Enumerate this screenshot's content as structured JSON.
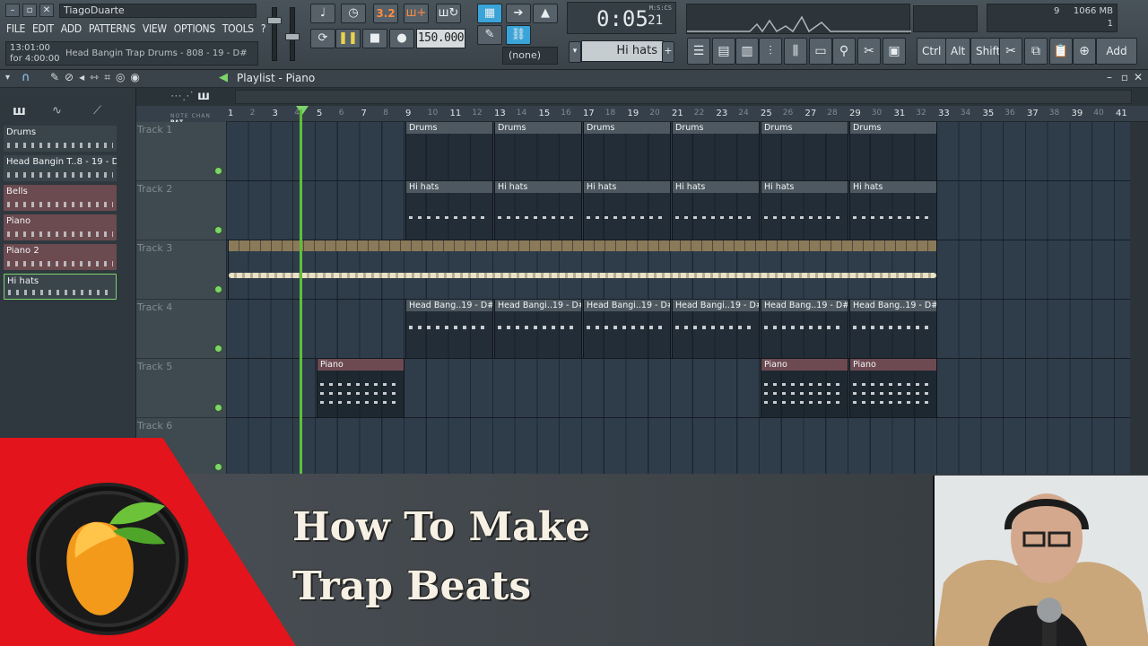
{
  "window": {
    "user": "TiagoDuarte"
  },
  "menu": [
    "FILE",
    "EDIT",
    "ADD",
    "PATTERNS",
    "VIEW",
    "OPTIONS",
    "TOOLS",
    "?"
  ],
  "hint": {
    "time": "13:01:00",
    "length": "for 4:00:00",
    "message": "Head Bangin Trap Drums - 808 - 19 - D#"
  },
  "transport": {
    "tempo": "150.000",
    "time_main": "0:05",
    "time_sub": "21",
    "time_unit": "M:S:CS",
    "pattern_mode": "3.2",
    "channel": "(none)"
  },
  "monitor": {
    "cpu_poly": "9",
    "memory": "1066 MB",
    "voices": "1"
  },
  "pattern_selector": {
    "label": "Hi hats"
  },
  "keys": {
    "ctrl": "Ctrl",
    "alt": "Alt",
    "shift": "Shift",
    "add": "Add"
  },
  "playlist": {
    "title": "Playlist - Piano"
  },
  "ruler_major": [
    "1",
    "3",
    "5",
    "7",
    "9",
    "11",
    "13",
    "15",
    "17",
    "19",
    "21",
    "23",
    "25",
    "27",
    "29",
    "31",
    "33",
    "35",
    "37",
    "39",
    "41"
  ],
  "patterns": [
    {
      "name": "Drums",
      "color": "#3a444b"
    },
    {
      "name": "Head Bangin T..8 - 19 - D#",
      "color": "#3a444b"
    },
    {
      "name": "Bells",
      "color": "#6b4a50"
    },
    {
      "name": "Piano",
      "color": "#6b4a50"
    },
    {
      "name": "Piano 2",
      "color": "#6b4a50"
    },
    {
      "name": "Hi hats",
      "color": "#3a444b"
    }
  ],
  "tracks": [
    "Track 1",
    "Track 2",
    "Track 3",
    "Track 4",
    "Track 5",
    "Track 6"
  ],
  "clips": {
    "drums": [
      "Drums",
      "Drums",
      "Drums",
      "Drums",
      "Drums",
      "Drums"
    ],
    "hihats": [
      "Hi hats",
      "Hi hats",
      "Hi hats",
      "Hi hats",
      "Hi hats",
      "Hi hats"
    ],
    "headbang": [
      "Head Bang..19 - D#",
      "Head Bangi..19 - D#",
      "Head Bangi..19 - D#",
      "Head Bangi..19 - D#",
      "Head Bang..19 - D#",
      "Head Bang..19 - D#"
    ],
    "piano": [
      "Piano",
      "Piano",
      "Piano"
    ]
  },
  "overlay": {
    "line1": "How To Make",
    "line2": "Trap Beats"
  }
}
